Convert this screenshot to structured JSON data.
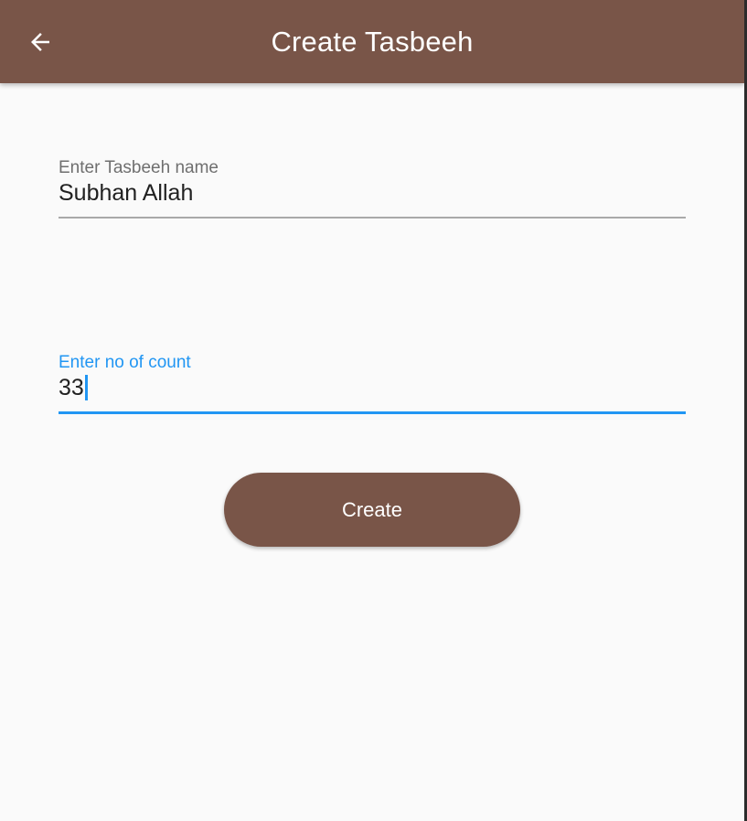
{
  "app_bar": {
    "title": "Create Tasbeeh",
    "back_icon": "arrow-back-icon",
    "color": "#795548"
  },
  "form": {
    "name_field": {
      "label": "Enter Tasbeeh name",
      "value": "Subhan Allah"
    },
    "count_field": {
      "label": "Enter no of count",
      "value": "33",
      "focused": true
    },
    "create_button_label": "Create"
  },
  "colors": {
    "primary": "#795548",
    "focus_accent": "#2196f3",
    "background": "#fafafa"
  }
}
